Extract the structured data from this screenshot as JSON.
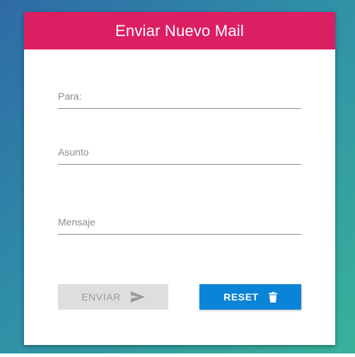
{
  "colors": {
    "header": "#dc1f62",
    "reset_button": "#0a84d6",
    "disabled_button": "#dedede"
  },
  "form": {
    "title": "Enviar Nuevo Mail",
    "fields": {
      "para": {
        "placeholder": "Para:",
        "value": ""
      },
      "asunto": {
        "placeholder": "Asunto",
        "value": ""
      },
      "mensaje": {
        "placeholder": "Mensaje",
        "value": ""
      }
    },
    "buttons": {
      "enviar": {
        "label": "ENVIAR",
        "icon": "send-icon",
        "disabled": true
      },
      "reset": {
        "label": "RESET",
        "icon": "trash-icon"
      }
    }
  }
}
